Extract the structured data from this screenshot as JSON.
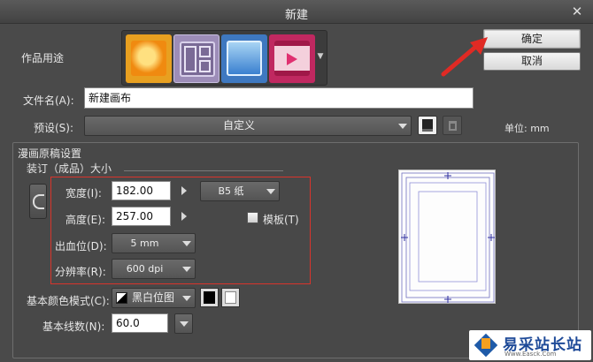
{
  "window": {
    "title": "新建",
    "close_icon": "close-icon"
  },
  "usage": {
    "label": "作品用途",
    "options": [
      {
        "name": "illustration",
        "color": "#e8a020"
      },
      {
        "name": "comic",
        "color": "#8a7aa8"
      },
      {
        "name": "webtoon",
        "color": "#4a8ad0"
      },
      {
        "name": "animation",
        "color": "#d0306a"
      }
    ],
    "selected": 1
  },
  "buttons": {
    "ok": "确定",
    "cancel": "取消"
  },
  "filename": {
    "label": "文件名(A):",
    "value": "新建画布"
  },
  "preset": {
    "label": "预设(S):",
    "value": "自定义"
  },
  "unit": {
    "label": "单位: mm"
  },
  "manuscript": {
    "section_title": "漫画原稿设置",
    "group_title": "装订（成品）大小",
    "width": {
      "label": "宽度(I):",
      "value": "182.00"
    },
    "height": {
      "label": "高度(E):",
      "value": "257.00"
    },
    "paper_size": "B5 纸",
    "template": {
      "label": "模板(T)",
      "checked": false
    },
    "bleed": {
      "label": "出血位(D):",
      "value": "5 mm"
    },
    "resolution": {
      "label": "分辨率(R):",
      "value": "600 dpi"
    },
    "color_mode": {
      "label": "基本颜色模式(C):",
      "value": "黑白位图"
    },
    "lpi": {
      "label": "基本线数(N):",
      "value": "60.0"
    }
  },
  "watermark": {
    "name": "易采站长站",
    "sub": "Www.Easck.Com"
  }
}
